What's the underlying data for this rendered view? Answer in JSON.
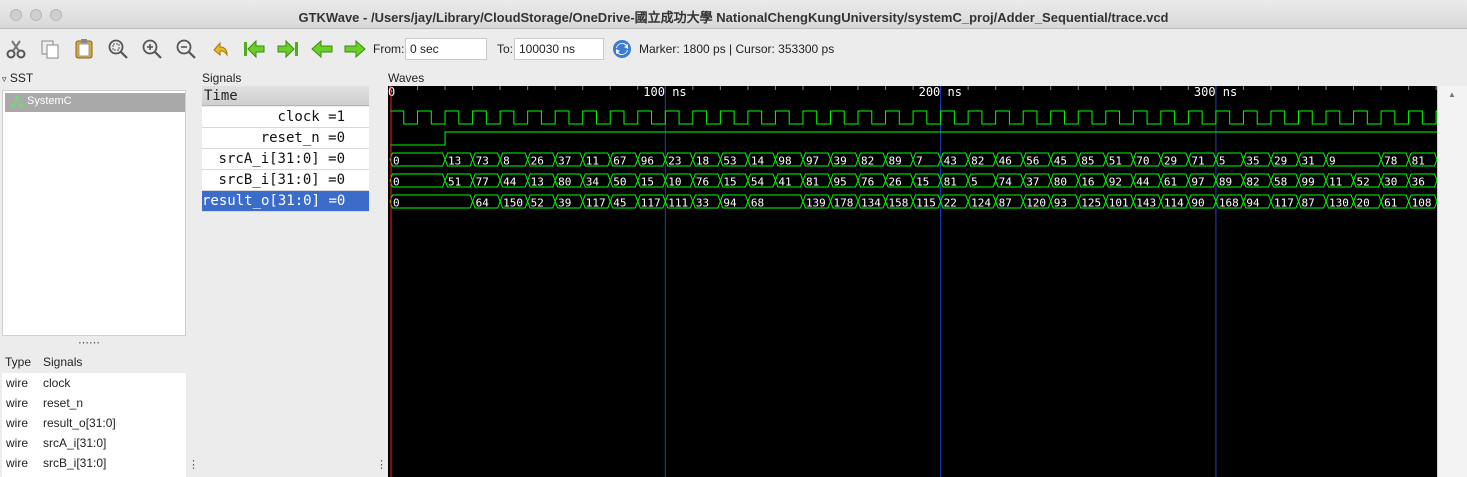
{
  "window": {
    "title": "GTKWave - /Users/jay/Library/CloudStorage/OneDrive-國立成功大學 NationalChengKungUniversity/systemC_proj/Adder_Sequential/trace.vcd"
  },
  "toolbar": {
    "icons": [
      "cut-icon",
      "copy-icon",
      "paste-icon",
      "zoom-fit-icon",
      "zoom-in-icon",
      "zoom-out-icon",
      "undo-zoom-icon",
      "go-first-icon",
      "go-last-icon",
      "back-icon",
      "forward-icon"
    ],
    "from_label": "From:",
    "from_value": "0 sec",
    "to_label": "To:",
    "to_value": "100030 ns",
    "reload_icon": "reload-icon",
    "marker_cursor": "Marker: 1800 ps  |  Cursor: 353300 ps"
  },
  "sst": {
    "header": "SST",
    "tree_item": "SystemC",
    "table_headers": {
      "type": "Type",
      "signals": "Signals"
    },
    "signals": [
      {
        "type": "wire",
        "name": "clock"
      },
      {
        "type": "wire",
        "name": "reset_n"
      },
      {
        "type": "wire",
        "name": "result_o[31:0]"
      },
      {
        "type": "wire",
        "name": "srcA_i[31:0]"
      },
      {
        "type": "wire",
        "name": "srcB_i[31:0]"
      }
    ]
  },
  "signals_panel": {
    "header": "Signals",
    "time_label": "Time",
    "rows": [
      {
        "name": "clock",
        "value": "=1"
      },
      {
        "name": "reset_n",
        "value": "=0"
      },
      {
        "name": "srcA_i[31:0]",
        "value": "=0"
      },
      {
        "name": "srcB_i[31:0]",
        "value": "=0"
      },
      {
        "name": "result_o[31:0]",
        "value": "=0"
      }
    ]
  },
  "waves_panel": {
    "header": "Waves",
    "time_labels": [
      {
        "t": 0,
        "label": "0"
      },
      {
        "t": 100,
        "label": "100 ns"
      },
      {
        "t": 200,
        "label": "200 ns"
      },
      {
        "t": 300,
        "label": "300 ns"
      }
    ],
    "visible_range_ns": [
      0,
      380
    ],
    "clock_period_ns": 10,
    "reset_release_ns": 20,
    "colors": {
      "wave": "#00ff00",
      "grid": "#1f3fbf",
      "marker": "#ff2020",
      "background": "#000000",
      "text": "#ffffff"
    },
    "srcA": [
      {
        "t": 0,
        "v": "0"
      },
      {
        "t": 20,
        "v": "13"
      },
      {
        "t": 30,
        "v": "73"
      },
      {
        "t": 40,
        "v": "8"
      },
      {
        "t": 50,
        "v": "26"
      },
      {
        "t": 60,
        "v": "37"
      },
      {
        "t": 70,
        "v": "11"
      },
      {
        "t": 80,
        "v": "67"
      },
      {
        "t": 90,
        "v": "96"
      },
      {
        "t": 100,
        "v": "23"
      },
      {
        "t": 110,
        "v": "18"
      },
      {
        "t": 120,
        "v": "53"
      },
      {
        "t": 130,
        "v": "14"
      },
      {
        "t": 140,
        "v": "98"
      },
      {
        "t": 150,
        "v": "97"
      },
      {
        "t": 160,
        "v": "39"
      },
      {
        "t": 170,
        "v": "82"
      },
      {
        "t": 180,
        "v": "89"
      },
      {
        "t": 190,
        "v": "7"
      },
      {
        "t": 200,
        "v": "43"
      },
      {
        "t": 210,
        "v": "82"
      },
      {
        "t": 220,
        "v": "46"
      },
      {
        "t": 230,
        "v": "56"
      },
      {
        "t": 240,
        "v": "45"
      },
      {
        "t": 250,
        "v": "85"
      },
      {
        "t": 260,
        "v": "51"
      },
      {
        "t": 270,
        "v": "70"
      },
      {
        "t": 280,
        "v": "29"
      },
      {
        "t": 290,
        "v": "71"
      },
      {
        "t": 300,
        "v": "5"
      },
      {
        "t": 310,
        "v": "35"
      },
      {
        "t": 320,
        "v": "29"
      },
      {
        "t": 330,
        "v": "31"
      },
      {
        "t": 340,
        "v": "9"
      },
      {
        "t": 360,
        "v": "78"
      },
      {
        "t": 370,
        "v": "81"
      }
    ],
    "srcB": [
      {
        "t": 0,
        "v": "0"
      },
      {
        "t": 20,
        "v": "51"
      },
      {
        "t": 30,
        "v": "77"
      },
      {
        "t": 40,
        "v": "44"
      },
      {
        "t": 50,
        "v": "13"
      },
      {
        "t": 60,
        "v": "80"
      },
      {
        "t": 70,
        "v": "34"
      },
      {
        "t": 80,
        "v": "50"
      },
      {
        "t": 90,
        "v": "15"
      },
      {
        "t": 100,
        "v": "10"
      },
      {
        "t": 110,
        "v": "76"
      },
      {
        "t": 120,
        "v": "15"
      },
      {
        "t": 130,
        "v": "54"
      },
      {
        "t": 140,
        "v": "41"
      },
      {
        "t": 150,
        "v": "81"
      },
      {
        "t": 160,
        "v": "95"
      },
      {
        "t": 170,
        "v": "76"
      },
      {
        "t": 180,
        "v": "26"
      },
      {
        "t": 190,
        "v": "15"
      },
      {
        "t": 200,
        "v": "81"
      },
      {
        "t": 210,
        "v": "5"
      },
      {
        "t": 220,
        "v": "74"
      },
      {
        "t": 230,
        "v": "37"
      },
      {
        "t": 240,
        "v": "80"
      },
      {
        "t": 250,
        "v": "16"
      },
      {
        "t": 260,
        "v": "92"
      },
      {
        "t": 270,
        "v": "44"
      },
      {
        "t": 280,
        "v": "61"
      },
      {
        "t": 290,
        "v": "97"
      },
      {
        "t": 300,
        "v": "89"
      },
      {
        "t": 310,
        "v": "82"
      },
      {
        "t": 320,
        "v": "58"
      },
      {
        "t": 330,
        "v": "99"
      },
      {
        "t": 340,
        "v": "11"
      },
      {
        "t": 350,
        "v": "52"
      },
      {
        "t": 360,
        "v": "30"
      },
      {
        "t": 370,
        "v": "36"
      }
    ],
    "result": [
      {
        "t": 0,
        "v": "0"
      },
      {
        "t": 30,
        "v": "64"
      },
      {
        "t": 40,
        "v": "150"
      },
      {
        "t": 50,
        "v": "52"
      },
      {
        "t": 60,
        "v": "39"
      },
      {
        "t": 70,
        "v": "117"
      },
      {
        "t": 80,
        "v": "45"
      },
      {
        "t": 90,
        "v": "117"
      },
      {
        "t": 100,
        "v": "111"
      },
      {
        "t": 110,
        "v": "33"
      },
      {
        "t": 120,
        "v": "94"
      },
      {
        "t": 130,
        "v": "68"
      },
      {
        "t": 150,
        "v": "139"
      },
      {
        "t": 160,
        "v": "178"
      },
      {
        "t": 170,
        "v": "134"
      },
      {
        "t": 180,
        "v": "158"
      },
      {
        "t": 190,
        "v": "115"
      },
      {
        "t": 200,
        "v": "22"
      },
      {
        "t": 210,
        "v": "124"
      },
      {
        "t": 220,
        "v": "87"
      },
      {
        "t": 230,
        "v": "120"
      },
      {
        "t": 240,
        "v": "93"
      },
      {
        "t": 250,
        "v": "125"
      },
      {
        "t": 260,
        "v": "101"
      },
      {
        "t": 270,
        "v": "143"
      },
      {
        "t": 280,
        "v": "114"
      },
      {
        "t": 290,
        "v": "90"
      },
      {
        "t": 300,
        "v": "168"
      },
      {
        "t": 310,
        "v": "94"
      },
      {
        "t": 320,
        "v": "117"
      },
      {
        "t": 330,
        "v": "87"
      },
      {
        "t": 340,
        "v": "130"
      },
      {
        "t": 350,
        "v": "20"
      },
      {
        "t": 360,
        "v": "61"
      },
      {
        "t": 370,
        "v": "108"
      }
    ]
  }
}
